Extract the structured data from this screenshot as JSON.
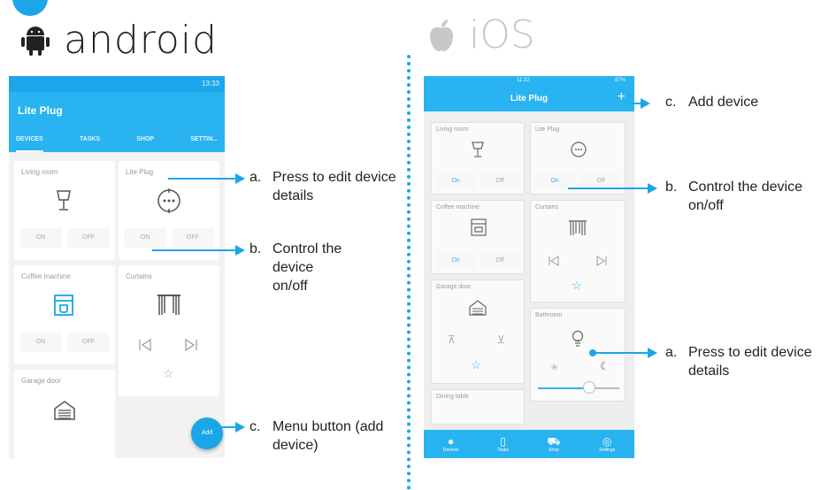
{
  "android": {
    "platform_name": "android",
    "status_time": "13:33",
    "app_title": "Lite Plug",
    "tabs": [
      "DEVICES",
      "TASKS",
      "SHOP",
      "SETTIN..."
    ],
    "cards": {
      "living_room": {
        "title": "Living room",
        "on": "ON",
        "off": "OFF"
      },
      "lite_plug": {
        "title": "Lite Plug",
        "on": "ON",
        "off": "OFF"
      },
      "coffee_machine": {
        "title": "Coffee machine",
        "on": "ON",
        "off": "OFF"
      },
      "curtains": {
        "title": "Curtains"
      },
      "garage_door": {
        "title": "Garage door"
      }
    },
    "fab_label": "Add"
  },
  "ios": {
    "platform_name": "iOS",
    "status_time": "11:22",
    "status_battery": "87%",
    "nav_title": "Lite Plug",
    "nav_add": "+",
    "cards": {
      "living_room": {
        "title": "Living room",
        "on": "On",
        "off": "Off"
      },
      "lite_plug": {
        "title": "Lite Plug",
        "on": "On",
        "off": "Off"
      },
      "coffee_machine": {
        "title": "Coffee machine",
        "on": "On",
        "off": "Off"
      },
      "curtains": {
        "title": "Curtains"
      },
      "garage_door": {
        "title": "Garage door"
      },
      "bathroom": {
        "title": "Bathroom"
      },
      "dining_table": {
        "title": "Dining table"
      }
    },
    "tabbar": [
      "Devices",
      "Tasks",
      "Shop",
      "Settings"
    ]
  },
  "callouts": {
    "android_a": {
      "letter": "a.",
      "text": "Press to edit device details"
    },
    "android_b": {
      "letter": "b.",
      "text": "Control the device on/off"
    },
    "android_c": {
      "letter": "c.",
      "text": "Menu button (add device)"
    },
    "ios_c": {
      "letter": "c.",
      "text": "Add device"
    },
    "ios_b": {
      "letter": "b.",
      "text": "Control the device on/off"
    },
    "ios_a": {
      "letter": "a.",
      "text": "Press to edit device details"
    }
  },
  "colors": {
    "accent": "#1aa6e8",
    "appbar": "#29b3f0"
  }
}
